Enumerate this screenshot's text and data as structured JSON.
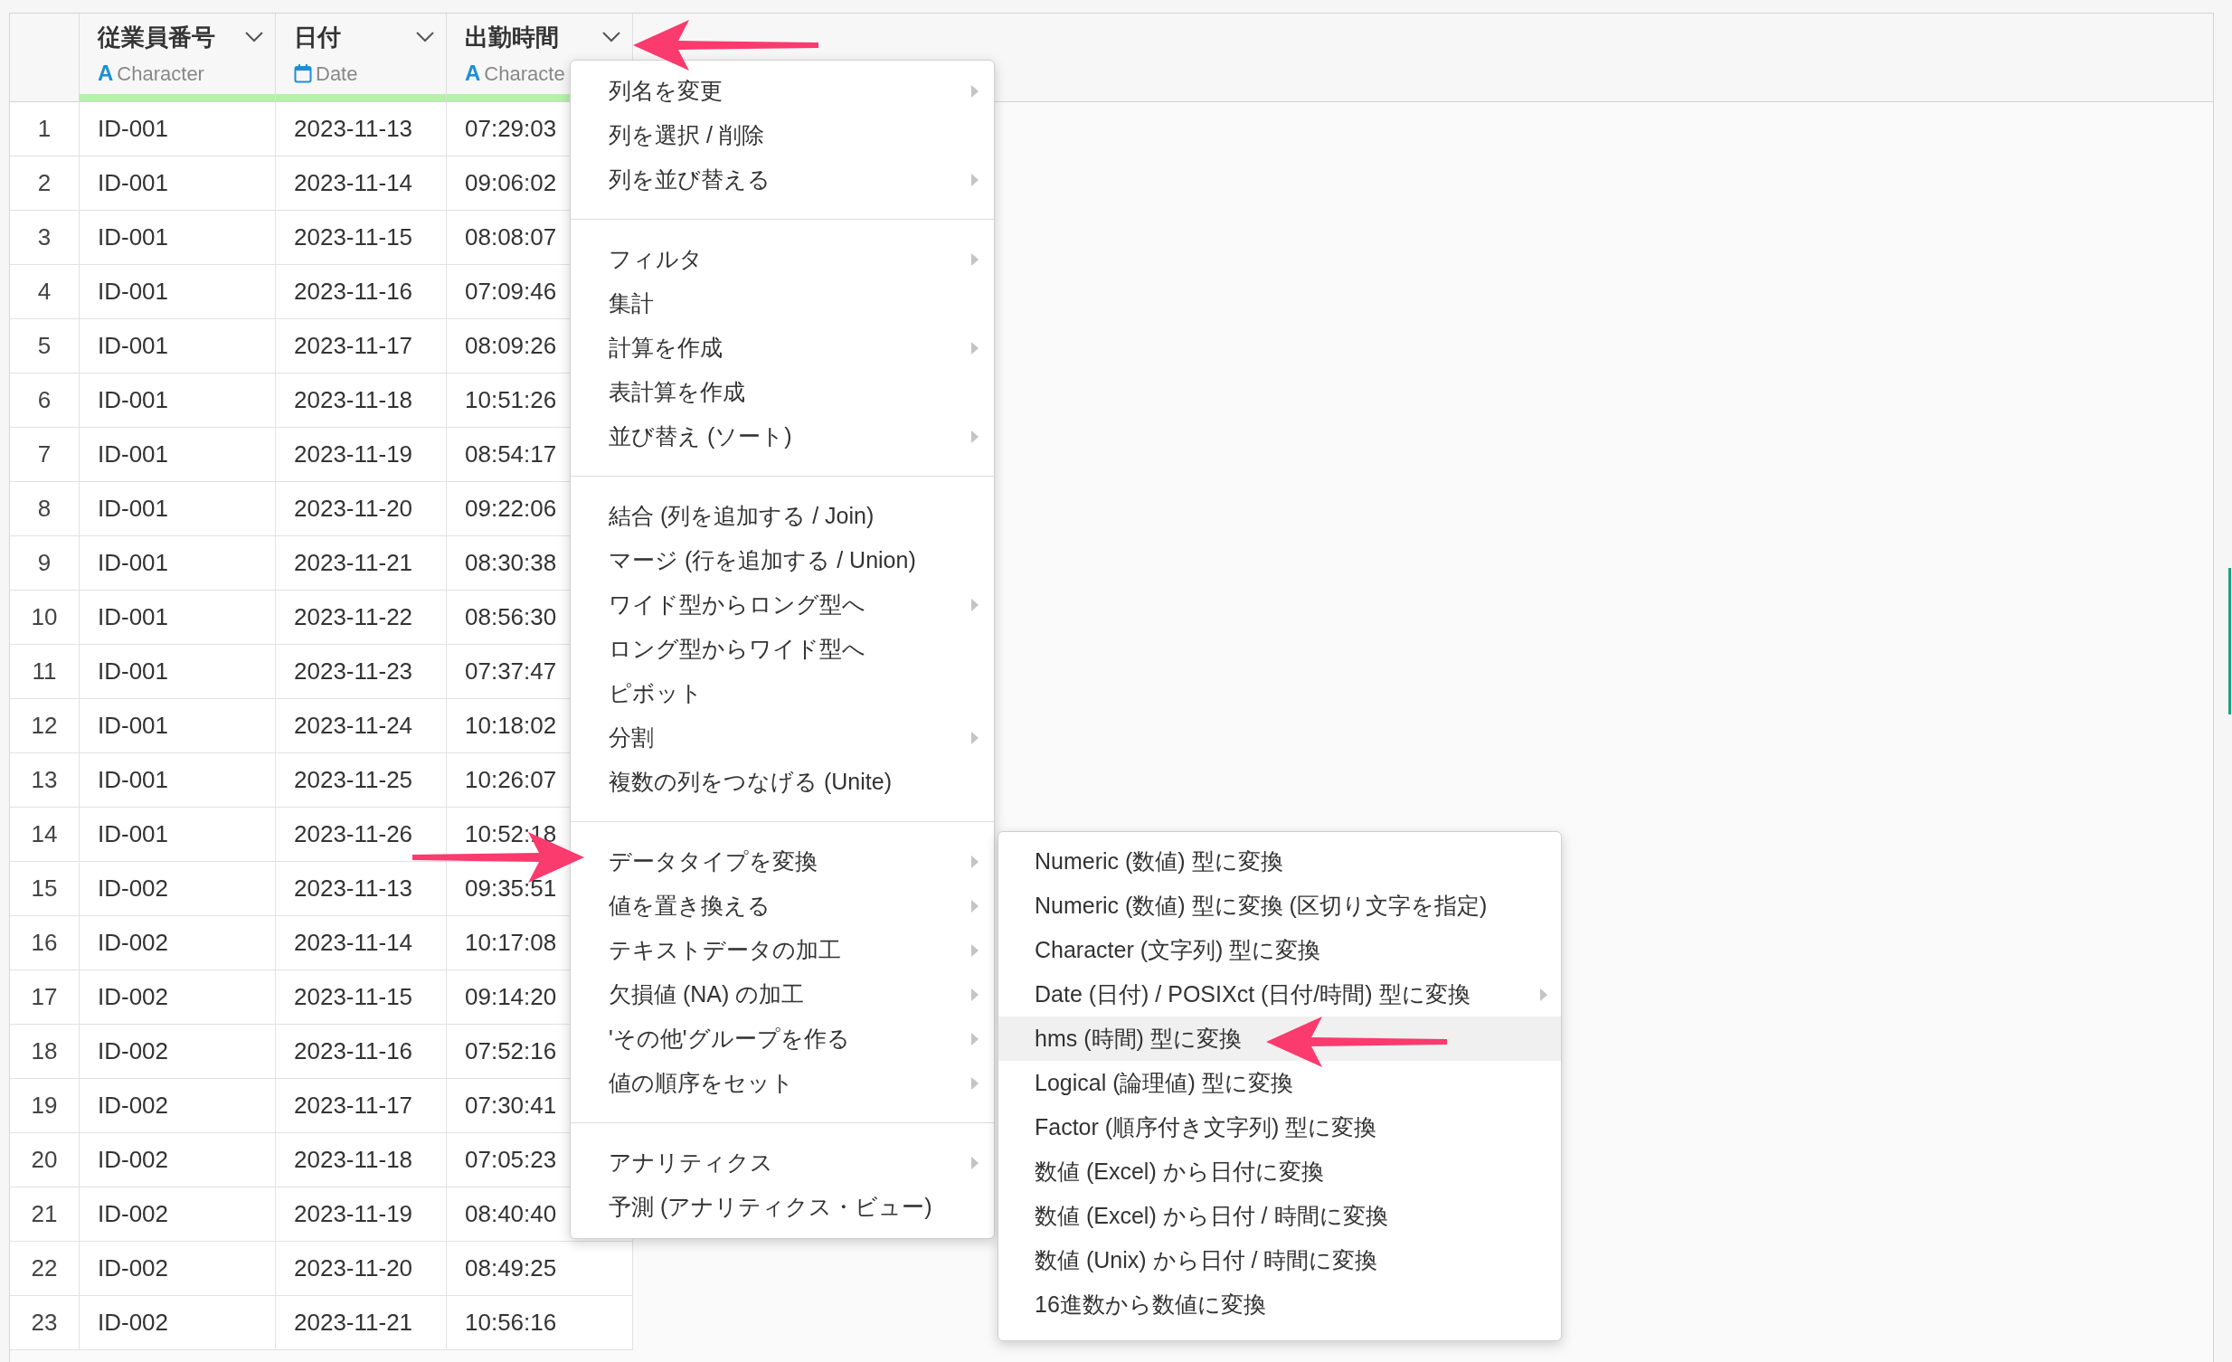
{
  "columns": [
    {
      "name": "従業員番号",
      "kind": "character",
      "type_icon": "A",
      "type_label": "Character"
    },
    {
      "name": "日付",
      "kind": "date",
      "type_label": "Date"
    },
    {
      "name": "出勤時間",
      "kind": "character",
      "type_icon": "A",
      "type_label": "Characte"
    }
  ],
  "rows": [
    {
      "index": "1",
      "cells": [
        "ID-001",
        "2023-11-13",
        "07:29:03"
      ]
    },
    {
      "index": "2",
      "cells": [
        "ID-001",
        "2023-11-14",
        "09:06:02"
      ]
    },
    {
      "index": "3",
      "cells": [
        "ID-001",
        "2023-11-15",
        "08:08:07"
      ]
    },
    {
      "index": "4",
      "cells": [
        "ID-001",
        "2023-11-16",
        "07:09:46"
      ]
    },
    {
      "index": "5",
      "cells": [
        "ID-001",
        "2023-11-17",
        "08:09:26"
      ]
    },
    {
      "index": "6",
      "cells": [
        "ID-001",
        "2023-11-18",
        "10:51:26"
      ]
    },
    {
      "index": "7",
      "cells": [
        "ID-001",
        "2023-11-19",
        "08:54:17"
      ]
    },
    {
      "index": "8",
      "cells": [
        "ID-001",
        "2023-11-20",
        "09:22:06"
      ]
    },
    {
      "index": "9",
      "cells": [
        "ID-001",
        "2023-11-21",
        "08:30:38"
      ]
    },
    {
      "index": "10",
      "cells": [
        "ID-001",
        "2023-11-22",
        "08:56:30"
      ]
    },
    {
      "index": "11",
      "cells": [
        "ID-001",
        "2023-11-23",
        "07:37:47"
      ]
    },
    {
      "index": "12",
      "cells": [
        "ID-001",
        "2023-11-24",
        "10:18:02"
      ]
    },
    {
      "index": "13",
      "cells": [
        "ID-001",
        "2023-11-25",
        "10:26:07"
      ]
    },
    {
      "index": "14",
      "cells": [
        "ID-001",
        "2023-11-26",
        "10:52:18"
      ]
    },
    {
      "index": "15",
      "cells": [
        "ID-002",
        "2023-11-13",
        "09:35:51"
      ]
    },
    {
      "index": "16",
      "cells": [
        "ID-002",
        "2023-11-14",
        "10:17:08"
      ]
    },
    {
      "index": "17",
      "cells": [
        "ID-002",
        "2023-11-15",
        "09:14:20"
      ]
    },
    {
      "index": "18",
      "cells": [
        "ID-002",
        "2023-11-16",
        "07:52:16"
      ]
    },
    {
      "index": "19",
      "cells": [
        "ID-002",
        "2023-11-17",
        "07:30:41"
      ]
    },
    {
      "index": "20",
      "cells": [
        "ID-002",
        "2023-11-18",
        "07:05:23"
      ]
    },
    {
      "index": "21",
      "cells": [
        "ID-002",
        "2023-11-19",
        "08:40:40"
      ]
    },
    {
      "index": "22",
      "cells": [
        "ID-002",
        "2023-11-20",
        "08:49:25"
      ]
    },
    {
      "index": "23",
      "cells": [
        "ID-002",
        "2023-11-21",
        "10:56:16"
      ]
    }
  ],
  "column_menu": {
    "groups": [
      {
        "items": [
          {
            "label": "列名を変更",
            "has_submenu": true
          },
          {
            "label": "列を選択 / 削除",
            "has_submenu": false
          },
          {
            "label": "列を並び替える",
            "has_submenu": true
          }
        ]
      },
      {
        "items": [
          {
            "label": "フィルタ",
            "has_submenu": true
          },
          {
            "label": "集計",
            "has_submenu": false
          },
          {
            "label": "計算を作成",
            "has_submenu": true
          },
          {
            "label": "表計算を作成",
            "has_submenu": false
          },
          {
            "label": "並び替え (ソート)",
            "has_submenu": true
          }
        ]
      },
      {
        "items": [
          {
            "label": "結合 (列を追加する / Join)",
            "has_submenu": false
          },
          {
            "label": "マージ (行を追加する / Union)",
            "has_submenu": false
          },
          {
            "label": "ワイド型からロング型へ",
            "has_submenu": true
          },
          {
            "label": "ロング型からワイド型へ",
            "has_submenu": false
          },
          {
            "label": "ピボット",
            "has_submenu": false
          },
          {
            "label": "分割",
            "has_submenu": true
          },
          {
            "label": "複数の列をつなげる (Unite)",
            "has_submenu": false
          }
        ]
      },
      {
        "items": [
          {
            "label": "データタイプを変換",
            "has_submenu": true
          },
          {
            "label": "値を置き換える",
            "has_submenu": true
          },
          {
            "label": "テキストデータの加工",
            "has_submenu": true
          },
          {
            "label": "欠損値 (NA) の加工",
            "has_submenu": true
          },
          {
            "label": "'その他'グループを作る",
            "has_submenu": true
          },
          {
            "label": "値の順序をセット",
            "has_submenu": true
          }
        ]
      },
      {
        "items": [
          {
            "label": "アナリティクス",
            "has_submenu": true
          },
          {
            "label": "予測 (アナリティクス・ビュー)",
            "has_submenu": false
          }
        ]
      }
    ]
  },
  "type_submenu": {
    "items": [
      {
        "label": "Numeric (数値) 型に変換",
        "has_submenu": false,
        "selected": false
      },
      {
        "label": "Numeric (数値) 型に変換 (区切り文字を指定)",
        "has_submenu": false,
        "selected": false
      },
      {
        "label": "Character (文字列) 型に変換",
        "has_submenu": false,
        "selected": false
      },
      {
        "label": "Date (日付) / POSIXct (日付/時間) 型に変換",
        "has_submenu": true,
        "selected": false
      },
      {
        "label": "hms (時間) 型に変換",
        "has_submenu": false,
        "selected": true
      },
      {
        "label": "Logical (論理値) 型に変換",
        "has_submenu": false,
        "selected": false
      },
      {
        "label": "Factor (順序付き文字列) 型に変換",
        "has_submenu": false,
        "selected": false
      },
      {
        "label": "数値 (Excel) から日付に変換",
        "has_submenu": false,
        "selected": false
      },
      {
        "label": "数値 (Excel) から日付 / 時間に変換",
        "has_submenu": false,
        "selected": false
      },
      {
        "label": "数値 (Unix) から日付 / 時間に変換",
        "has_submenu": false,
        "selected": false
      },
      {
        "label": "16進数から数値に変換",
        "has_submenu": false,
        "selected": false
      }
    ]
  }
}
